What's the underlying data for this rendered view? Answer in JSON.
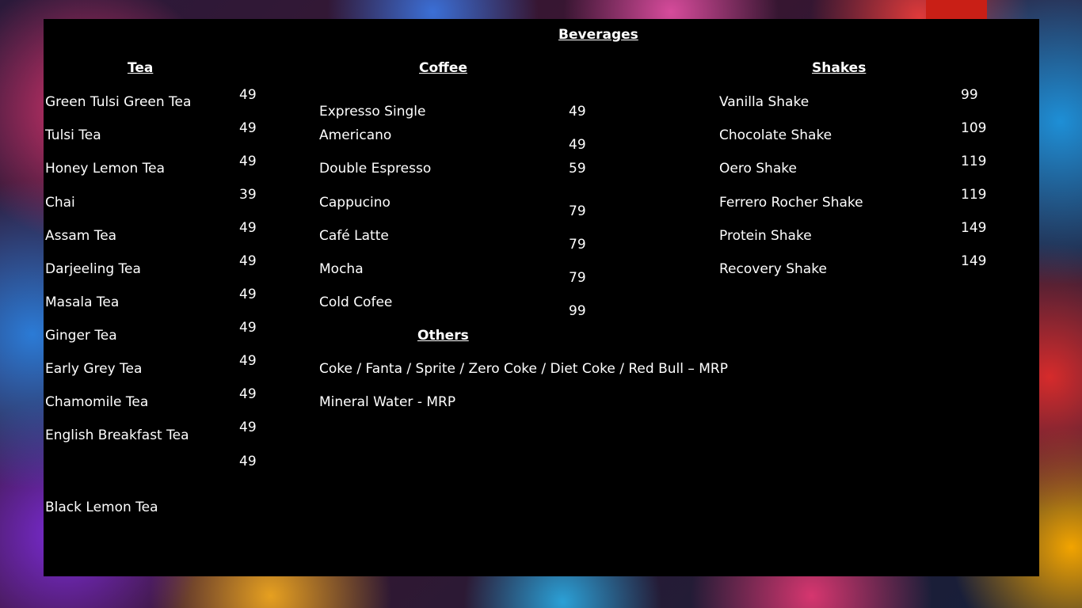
{
  "menu": {
    "title": "Beverages",
    "tea": {
      "heading": "Tea",
      "items": [
        "Green Tulsi Green Tea",
        "Tulsi Tea",
        "Honey Lemon Tea",
        "Chai",
        "Assam Tea",
        "Darjeeling Tea",
        "Masala Tea",
        "Ginger Tea",
        "Early Grey Tea",
        "Chamomile Tea",
        "English Breakfast Tea",
        "Black Lemon Tea"
      ],
      "prices": [
        "49",
        "49",
        "49",
        "39",
        "49",
        "49",
        "49",
        "49",
        "49",
        "49",
        "49",
        "49"
      ]
    },
    "coffee": {
      "heading": "Coffee",
      "items": [
        "Expresso Single",
        "Americano",
        "Double Espresso",
        "Cappucino",
        "Café Latte",
        "Mocha",
        "Cold Cofee"
      ],
      "prices": [
        "49",
        "49",
        "59",
        "79",
        "79",
        "79",
        "99"
      ]
    },
    "shakes": {
      "heading": "Shakes",
      "items": [
        "Vanilla Shake",
        "Chocolate Shake",
        "Oero Shake",
        "Ferrero Rocher Shake",
        "Protein Shake",
        "Recovery Shake"
      ],
      "prices": [
        "99",
        "109",
        "119",
        "119",
        "149",
        "149"
      ]
    },
    "others": {
      "heading": "Others",
      "items": [
        "Coke / Fanta / Sprite / Zero Coke / Diet Coke / Red Bull – MRP",
        "Mineral Water - MRP"
      ]
    }
  },
  "colors": {
    "panel": "#000000",
    "text": "#ffffff",
    "accent": "#c91f16"
  }
}
